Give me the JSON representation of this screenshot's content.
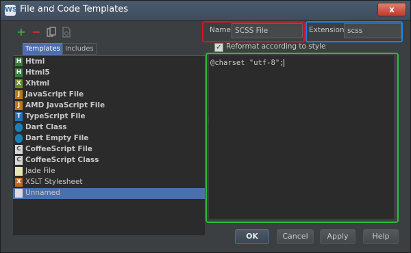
{
  "window": {
    "title": "File and Code Templates",
    "icon_name": "webstorm-logo-icon",
    "close_label": "x"
  },
  "toolbar": {
    "add_glyph": "+",
    "remove_glyph": "−",
    "icons": [
      "add-icon",
      "remove-icon",
      "copy-icon",
      "reset-icon"
    ],
    "colors": {
      "add": "#3fa33f",
      "remove": "#d03030"
    }
  },
  "tabs": [
    {
      "label": "Templates",
      "active": true
    },
    {
      "label": "Includes",
      "active": false
    }
  ],
  "templates": [
    {
      "label": "Html",
      "icon": "html-file-icon",
      "bold": true
    },
    {
      "label": "Html5",
      "icon": "html-file-icon",
      "bold": true
    },
    {
      "label": "Xhtml",
      "icon": "xhtml-file-icon",
      "bold": true
    },
    {
      "label": "JavaScript File",
      "icon": "javascript-file-icon",
      "bold": true
    },
    {
      "label": "AMD JavaScript File",
      "icon": "javascript-file-icon",
      "bold": true
    },
    {
      "label": "TypeScript File",
      "icon": "typescript-file-icon",
      "bold": true
    },
    {
      "label": "Dart Class",
      "icon": "dart-icon",
      "bold": true
    },
    {
      "label": "Dart Empty File",
      "icon": "dart-icon",
      "bold": true
    },
    {
      "label": "CoffeeScript File",
      "icon": "coffeescript-file-icon",
      "bold": true
    },
    {
      "label": "CoffeeScript Class",
      "icon": "coffeescript-file-icon",
      "bold": true
    },
    {
      "label": "Jade File",
      "icon": "jade-file-icon",
      "bold": false
    },
    {
      "label": "XSLT Stylesheet",
      "icon": "xslt-file-icon",
      "bold": false
    },
    {
      "label": "Unnamed",
      "icon": "generic-file-icon",
      "bold": false,
      "selected": true
    }
  ],
  "form": {
    "name_label": "Name:",
    "name_value": "SCSS File",
    "extension_label": "Extension:",
    "extension_value": "scss",
    "reformat_label": "Reformat according to style",
    "reformat_checked": true
  },
  "editor": {
    "content": "@charset \"utf-8\";"
  },
  "buttons": {
    "ok": "OK",
    "cancel": "Cancel",
    "apply": "Apply",
    "help": "Help"
  },
  "highlights": {
    "name_box_color": "#e0102a",
    "extension_box_color": "#1e7fe8",
    "editor_box_color": "#2bbd3a"
  }
}
